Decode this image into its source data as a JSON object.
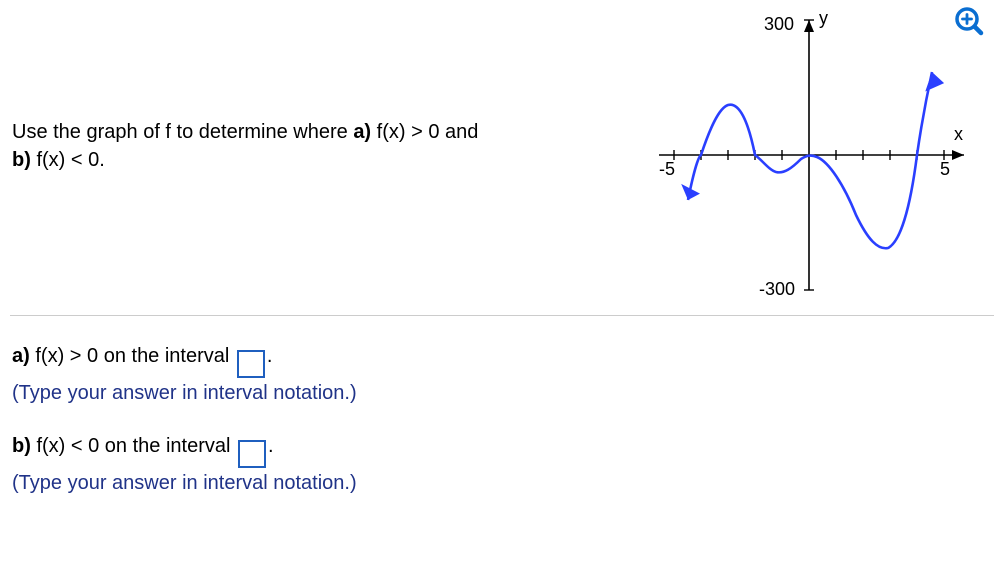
{
  "prompt": {
    "line1_prefix": "Use the graph of f to determine where ",
    "bold_a": "a)",
    "line1_mid": " f(x) > 0 and",
    "bold_b": "b)",
    "line2_rest": " f(x) < 0."
  },
  "zoom_icon_name": "zoom-in-icon",
  "graph": {
    "x_axis_label": "x",
    "y_axis_label": "y",
    "x_min_label": "-5",
    "x_max_label": "5",
    "y_max_label": "300",
    "y_min_label": "-300",
    "axis_color": "#000000",
    "curve_color": "#2a3fff",
    "arrow_fill": "#2a3fff"
  },
  "answers": {
    "a": {
      "bold": "a)",
      "text_before": " f(x) > 0 on the interval ",
      "text_after": ".",
      "hint": "(Type your answer in interval notation.)"
    },
    "b": {
      "bold": "b)",
      "text_before": " f(x) < 0 on the interval ",
      "text_after": ".",
      "hint": "(Type your answer in interval notation.)"
    }
  }
}
